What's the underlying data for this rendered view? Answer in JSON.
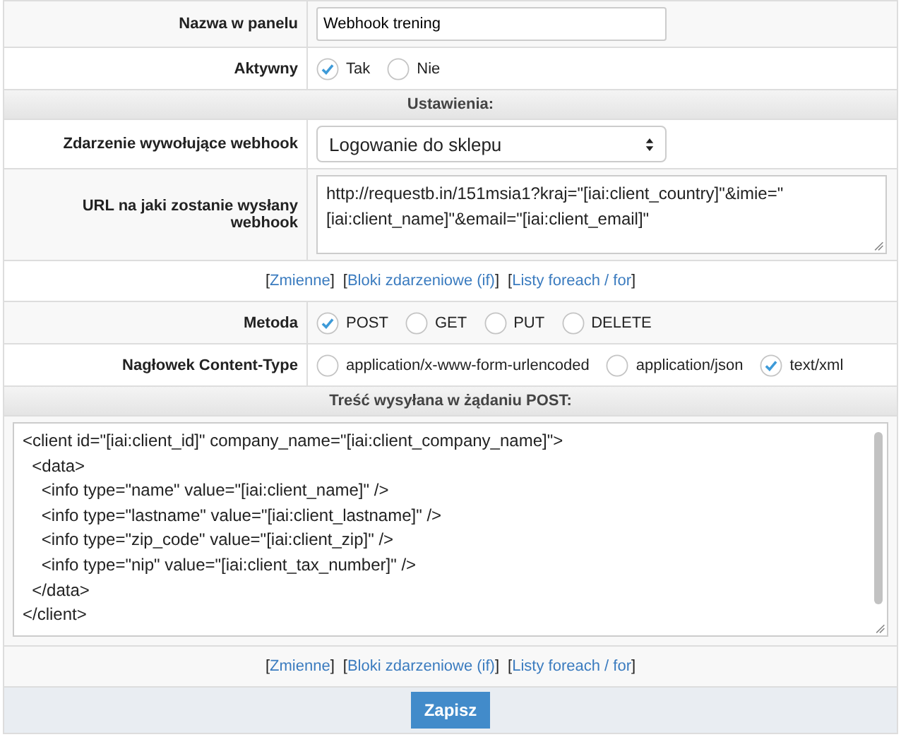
{
  "name_row": {
    "label": "Nazwa w panelu",
    "value": "Webhook trening"
  },
  "active_row": {
    "label": "Aktywny",
    "options": [
      {
        "label": "Tak",
        "selected": true
      },
      {
        "label": "Nie",
        "selected": false
      }
    ]
  },
  "settings_header": "Ustawienia:",
  "event_row": {
    "label": "Zdarzenie wywołujące webhook",
    "value": "Logowanie do sklepu"
  },
  "url_row": {
    "label": "URL na jaki zostanie wysłany webhook",
    "value": "http://requestb.in/151msia1?kraj=\"[iai:client_country]\"&imie=\"[iai:client_name]\"&email=\"[iai:client_email]\""
  },
  "links_top": [
    {
      "open": "[",
      "label": "Zmienne",
      "close": "]"
    },
    {
      "open": "[",
      "label": "Bloki zdarzeniowe (if)",
      "close": "]"
    },
    {
      "open": "[",
      "label": "Listy foreach / for",
      "close": "]"
    }
  ],
  "method_row": {
    "label": "Metoda",
    "options": [
      {
        "label": "POST",
        "selected": true
      },
      {
        "label": "GET",
        "selected": false
      },
      {
        "label": "PUT",
        "selected": false
      },
      {
        "label": "DELETE",
        "selected": false
      }
    ]
  },
  "content_type_row": {
    "label": "Nagłowek Content-Type",
    "options": [
      {
        "label": "application/x-www-form-urlencoded",
        "selected": false
      },
      {
        "label": "application/json",
        "selected": false
      },
      {
        "label": "text/xml",
        "selected": true
      }
    ]
  },
  "body_header": "Treść wysyłana w żądaniu POST:",
  "body_lines": [
    "<client id=\"[iai:client_id]\" company_name=\"[iai:client_company_name]\">",
    "  <data>",
    "    <info type=\"name\" value=\"[iai:client_name]\" />",
    "    <info type=\"lastname\" value=\"[iai:client_lastname]\" />",
    "    <info type=\"zip_code\" value=\"[iai:client_zip]\" />",
    "    <info type=\"nip\" value=\"[iai:client_tax_number]\" />",
    "  </data>",
    "</client>"
  ],
  "links_bottom": [
    {
      "open": "[",
      "label": "Zmienne",
      "close": "]"
    },
    {
      "open": "[",
      "label": "Bloki zdarzeniowe (if)",
      "close": "]"
    },
    {
      "open": "[",
      "label": "Listy foreach / for",
      "close": "]"
    }
  ],
  "save_button": "Zapisz"
}
